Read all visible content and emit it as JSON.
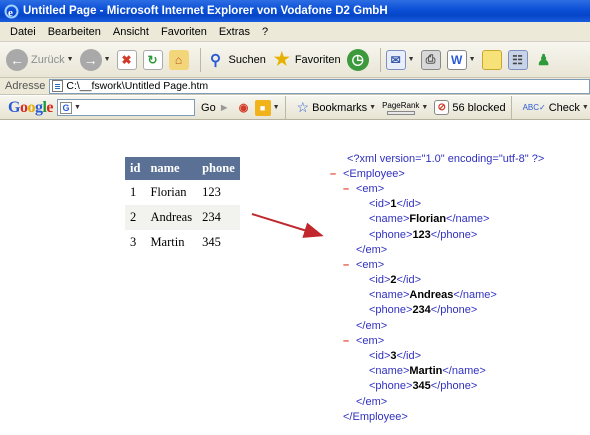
{
  "window": {
    "title": "Untitled Page - Microsoft Internet Explorer von Vodafone D2 GmbH"
  },
  "menu": {
    "items": [
      "Datei",
      "Bearbeiten",
      "Ansicht",
      "Favoriten",
      "Extras",
      "?"
    ]
  },
  "toolbar": {
    "back_label": "Zurück",
    "search_label": "Suchen",
    "favorites_label": "Favoriten"
  },
  "address": {
    "label": "Adresse",
    "value": "C:\\__fswork\\Untitled Page.htm"
  },
  "googlebar": {
    "logo": "Google",
    "search_value": "",
    "go_label": "Go",
    "bookmarks_label": "Bookmarks",
    "pagerank_label": "PageRank",
    "blocked_label": "56 blocked",
    "check_label": "Check"
  },
  "table": {
    "headers": [
      "id",
      "name",
      "phone"
    ],
    "rows": [
      [
        "1",
        "Florian",
        "123"
      ],
      [
        "2",
        "Andreas",
        "234"
      ],
      [
        "3",
        "Martin",
        "345"
      ]
    ]
  },
  "xml": {
    "declaration": "<?xml version=\"1.0\" encoding=\"utf-8\" ?>",
    "root_open": "<Employee>",
    "root_close": "</Employee>",
    "em_open": "<em>",
    "em_close": "</em>",
    "records": [
      {
        "id": "1",
        "name": "Florian",
        "phone": "123"
      },
      {
        "id": "2",
        "name": "Andreas",
        "phone": "234"
      },
      {
        "id": "3",
        "name": "Martin",
        "phone": "345"
      }
    ]
  },
  "colors": {
    "title_bar": "#0a4fd6",
    "table_header": "#5a7195",
    "arrow": "#c0282d",
    "xml_tag": "#3030c0",
    "xml_minus": "#e23a2b"
  }
}
